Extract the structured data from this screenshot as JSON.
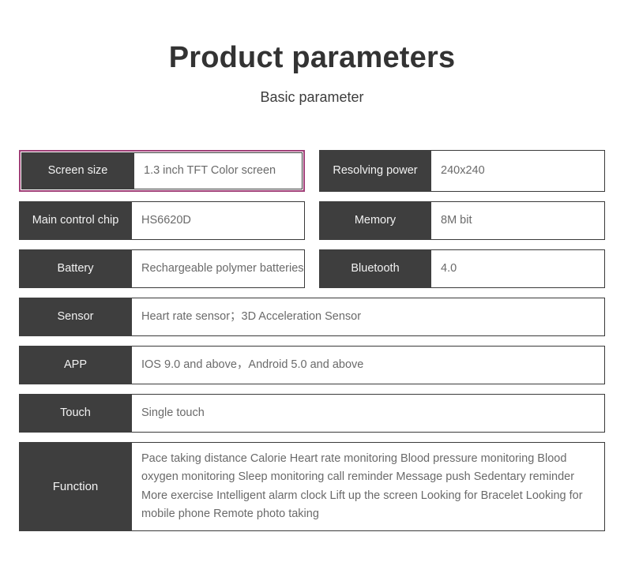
{
  "header": {
    "title": "Product parameters",
    "subtitle": "Basic parameter"
  },
  "colors": {
    "label_bg": "#3e3e3e",
    "label_text": "#f2f2f2",
    "value_text": "#6a6a6a",
    "highlight_border": "#a03f77",
    "page_bg": "#ffffff",
    "title_text": "#333333"
  },
  "spec_rows": [
    {
      "left": {
        "label": "Screen size",
        "value": "1.3  inch TFT Color screen",
        "highlighted": true
      },
      "right": {
        "label": "Resolving power",
        "value": "240x240",
        "highlighted": false
      }
    },
    {
      "left": {
        "label": "Main control chip",
        "value": "HS6620D",
        "highlighted": false
      },
      "right": {
        "label": "Memory",
        "value": "8M bit",
        "highlighted": false
      }
    },
    {
      "left": {
        "label": "Battery",
        "value": "Rechargeable polymer batteries",
        "highlighted": false
      },
      "right": {
        "label": "Bluetooth",
        "value": "4.0",
        "highlighted": false
      }
    }
  ],
  "full_rows": [
    {
      "label": "Sensor",
      "value": "Heart rate sensor；3D Acceleration Sensor"
    },
    {
      "label": "APP",
      "value": "IOS 9.0 and above，Android 5.0 and above"
    },
    {
      "label": "Touch",
      "value": "Single touch"
    }
  ],
  "function_row": {
    "label": "Function",
    "value": "Pace taking  distance  Calorie  Heart rate monitoring  Blood pressure monitoring  Blood oxygen monitoring  Sleep monitoring  call reminder  Message push  Sedentary reminder  More exercise  Intelligent alarm clock Lift up the screen  Looking for Bracelet  Looking for mobile phone  Remote photo taking"
  }
}
